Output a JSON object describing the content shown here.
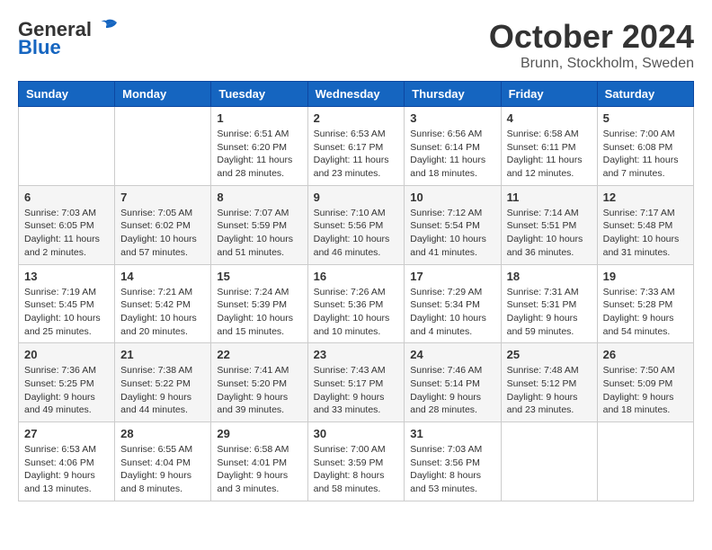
{
  "header": {
    "logo_general": "General",
    "logo_blue": "Blue",
    "month_title": "October 2024",
    "location": "Brunn, Stockholm, Sweden"
  },
  "days_of_week": [
    "Sunday",
    "Monday",
    "Tuesday",
    "Wednesday",
    "Thursday",
    "Friday",
    "Saturday"
  ],
  "weeks": [
    [
      {
        "day": "",
        "content": ""
      },
      {
        "day": "",
        "content": ""
      },
      {
        "day": "1",
        "content": "Sunrise: 6:51 AM\nSunset: 6:20 PM\nDaylight: 11 hours and 28 minutes."
      },
      {
        "day": "2",
        "content": "Sunrise: 6:53 AM\nSunset: 6:17 PM\nDaylight: 11 hours and 23 minutes."
      },
      {
        "day": "3",
        "content": "Sunrise: 6:56 AM\nSunset: 6:14 PM\nDaylight: 11 hours and 18 minutes."
      },
      {
        "day": "4",
        "content": "Sunrise: 6:58 AM\nSunset: 6:11 PM\nDaylight: 11 hours and 12 minutes."
      },
      {
        "day": "5",
        "content": "Sunrise: 7:00 AM\nSunset: 6:08 PM\nDaylight: 11 hours and 7 minutes."
      }
    ],
    [
      {
        "day": "6",
        "content": "Sunrise: 7:03 AM\nSunset: 6:05 PM\nDaylight: 11 hours and 2 minutes."
      },
      {
        "day": "7",
        "content": "Sunrise: 7:05 AM\nSunset: 6:02 PM\nDaylight: 10 hours and 57 minutes."
      },
      {
        "day": "8",
        "content": "Sunrise: 7:07 AM\nSunset: 5:59 PM\nDaylight: 10 hours and 51 minutes."
      },
      {
        "day": "9",
        "content": "Sunrise: 7:10 AM\nSunset: 5:56 PM\nDaylight: 10 hours and 46 minutes."
      },
      {
        "day": "10",
        "content": "Sunrise: 7:12 AM\nSunset: 5:54 PM\nDaylight: 10 hours and 41 minutes."
      },
      {
        "day": "11",
        "content": "Sunrise: 7:14 AM\nSunset: 5:51 PM\nDaylight: 10 hours and 36 minutes."
      },
      {
        "day": "12",
        "content": "Sunrise: 7:17 AM\nSunset: 5:48 PM\nDaylight: 10 hours and 31 minutes."
      }
    ],
    [
      {
        "day": "13",
        "content": "Sunrise: 7:19 AM\nSunset: 5:45 PM\nDaylight: 10 hours and 25 minutes."
      },
      {
        "day": "14",
        "content": "Sunrise: 7:21 AM\nSunset: 5:42 PM\nDaylight: 10 hours and 20 minutes."
      },
      {
        "day": "15",
        "content": "Sunrise: 7:24 AM\nSunset: 5:39 PM\nDaylight: 10 hours and 15 minutes."
      },
      {
        "day": "16",
        "content": "Sunrise: 7:26 AM\nSunset: 5:36 PM\nDaylight: 10 hours and 10 minutes."
      },
      {
        "day": "17",
        "content": "Sunrise: 7:29 AM\nSunset: 5:34 PM\nDaylight: 10 hours and 4 minutes."
      },
      {
        "day": "18",
        "content": "Sunrise: 7:31 AM\nSunset: 5:31 PM\nDaylight: 9 hours and 59 minutes."
      },
      {
        "day": "19",
        "content": "Sunrise: 7:33 AM\nSunset: 5:28 PM\nDaylight: 9 hours and 54 minutes."
      }
    ],
    [
      {
        "day": "20",
        "content": "Sunrise: 7:36 AM\nSunset: 5:25 PM\nDaylight: 9 hours and 49 minutes."
      },
      {
        "day": "21",
        "content": "Sunrise: 7:38 AM\nSunset: 5:22 PM\nDaylight: 9 hours and 44 minutes."
      },
      {
        "day": "22",
        "content": "Sunrise: 7:41 AM\nSunset: 5:20 PM\nDaylight: 9 hours and 39 minutes."
      },
      {
        "day": "23",
        "content": "Sunrise: 7:43 AM\nSunset: 5:17 PM\nDaylight: 9 hours and 33 minutes."
      },
      {
        "day": "24",
        "content": "Sunrise: 7:46 AM\nSunset: 5:14 PM\nDaylight: 9 hours and 28 minutes."
      },
      {
        "day": "25",
        "content": "Sunrise: 7:48 AM\nSunset: 5:12 PM\nDaylight: 9 hours and 23 minutes."
      },
      {
        "day": "26",
        "content": "Sunrise: 7:50 AM\nSunset: 5:09 PM\nDaylight: 9 hours and 18 minutes."
      }
    ],
    [
      {
        "day": "27",
        "content": "Sunrise: 6:53 AM\nSunset: 4:06 PM\nDaylight: 9 hours and 13 minutes."
      },
      {
        "day": "28",
        "content": "Sunrise: 6:55 AM\nSunset: 4:04 PM\nDaylight: 9 hours and 8 minutes."
      },
      {
        "day": "29",
        "content": "Sunrise: 6:58 AM\nSunset: 4:01 PM\nDaylight: 9 hours and 3 minutes."
      },
      {
        "day": "30",
        "content": "Sunrise: 7:00 AM\nSunset: 3:59 PM\nDaylight: 8 hours and 58 minutes."
      },
      {
        "day": "31",
        "content": "Sunrise: 7:03 AM\nSunset: 3:56 PM\nDaylight: 8 hours and 53 minutes."
      },
      {
        "day": "",
        "content": ""
      },
      {
        "day": "",
        "content": ""
      }
    ]
  ]
}
